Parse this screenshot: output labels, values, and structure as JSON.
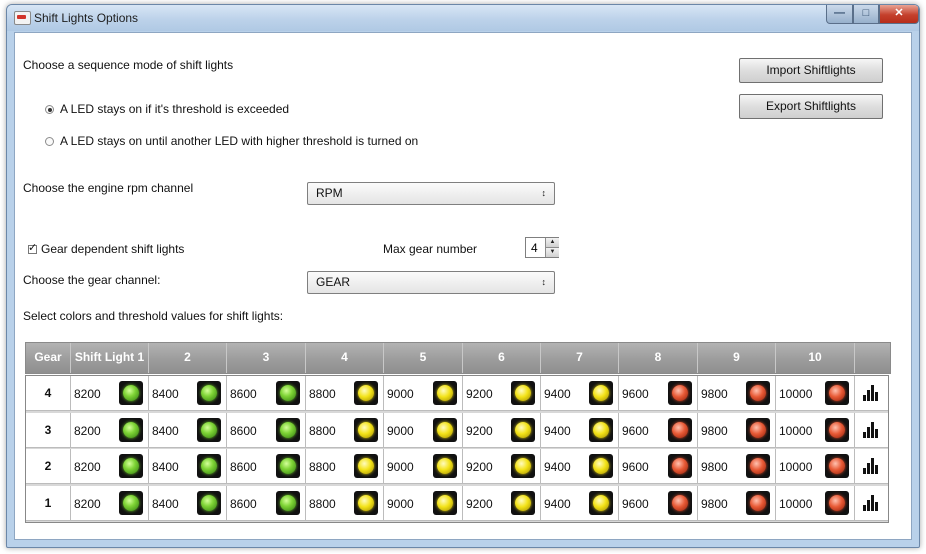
{
  "window": {
    "title": "Shift Lights Options",
    "controls": {
      "minimize": "—",
      "maximize": "□",
      "close": "✕"
    }
  },
  "sequence": {
    "heading": "Choose a sequence mode of shift lights",
    "options": [
      {
        "label": "A LED stays on if it's threshold is exceeded",
        "selected": true
      },
      {
        "label": "A LED stays on until another LED with higher threshold is turned on",
        "selected": false
      }
    ]
  },
  "buttons": {
    "import": "Import Shiftlights",
    "export": "Export Shiftlights"
  },
  "rpm": {
    "label": "Choose the engine rpm channel",
    "value": "RPM",
    "arrow": "↕"
  },
  "gear_dependent": {
    "label": "Gear dependent shift lights",
    "checked": true
  },
  "max_gear": {
    "label": "Max gear number",
    "value": "4"
  },
  "gear_channel": {
    "label": "Choose the gear channel:",
    "value": "GEAR",
    "arrow": "↕"
  },
  "table_title": "Select colors and threshold values for shift lights:",
  "table": {
    "headers": [
      "Gear",
      "Shift Light 1",
      "2",
      "3",
      "4",
      "5",
      "6",
      "7",
      "8",
      "9",
      "10"
    ],
    "led_colors": [
      "green",
      "green",
      "green",
      "yellow",
      "yellow",
      "yellow",
      "yellow",
      "red",
      "red",
      "red"
    ],
    "colors_hex": {
      "green": "#7fd436",
      "yellow": "#f3e318",
      "red": "#e85a36"
    },
    "rows": [
      {
        "gear": "4",
        "thresholds": [
          "8200",
          "8400",
          "8600",
          "8800",
          "9000",
          "9200",
          "9400",
          "9600",
          "9800",
          "10000"
        ]
      },
      {
        "gear": "3",
        "thresholds": [
          "8200",
          "8400",
          "8600",
          "8800",
          "9000",
          "9200",
          "9400",
          "9600",
          "9800",
          "10000"
        ]
      },
      {
        "gear": "2",
        "thresholds": [
          "8200",
          "8400",
          "8600",
          "8800",
          "9000",
          "9200",
          "9400",
          "9600",
          "9800",
          "10000"
        ]
      },
      {
        "gear": "1",
        "thresholds": [
          "8200",
          "8400",
          "8600",
          "8800",
          "9000",
          "9200",
          "9400",
          "9600",
          "9800",
          "10000"
        ]
      }
    ],
    "row_action_icon": "bar-chart-icon"
  }
}
